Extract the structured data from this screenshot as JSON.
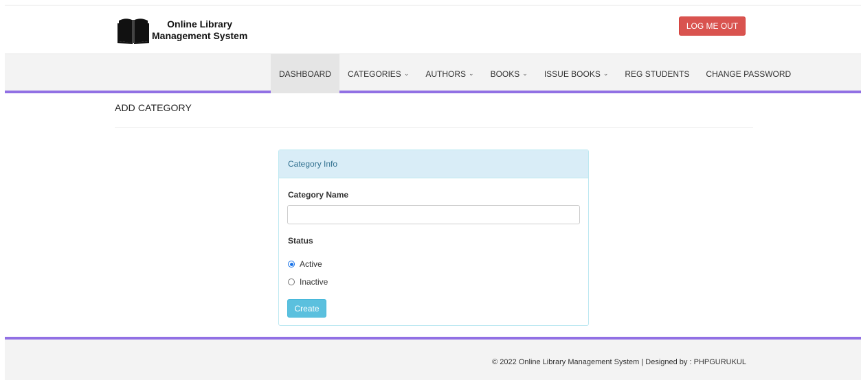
{
  "header": {
    "logo_line1": "Online Library",
    "logo_line2": "Management System",
    "logo_icon": "open-book-icon",
    "logout_label": "LOG ME OUT"
  },
  "nav": {
    "items": [
      {
        "label": "DASHBOARD",
        "dropdown": false,
        "active": true
      },
      {
        "label": "CATEGORIES",
        "dropdown": true,
        "active": false
      },
      {
        "label": "AUTHORS",
        "dropdown": true,
        "active": false
      },
      {
        "label": "BOOKS",
        "dropdown": true,
        "active": false
      },
      {
        "label": "ISSUE BOOKS",
        "dropdown": true,
        "active": false
      },
      {
        "label": "REG STUDENTS",
        "dropdown": false,
        "active": false
      },
      {
        "label": "CHANGE PASSWORD",
        "dropdown": false,
        "active": false
      }
    ]
  },
  "page": {
    "title": "ADD CATEGORY"
  },
  "form": {
    "panel_heading": "Category Info",
    "name_label": "Category Name",
    "name_value": "",
    "status_label": "Status",
    "options": [
      {
        "label": "Active",
        "checked": true
      },
      {
        "label": "Inactive",
        "checked": false
      }
    ],
    "submit_label": "Create"
  },
  "footer": {
    "text": "© 2022 Online Library Management System | Designed by : PHPGURUKUL"
  },
  "colors": {
    "accent": "#9170e4",
    "logout": "#d9534f",
    "info_panel": "#d9edf7",
    "create_button": "#5bc0de"
  }
}
